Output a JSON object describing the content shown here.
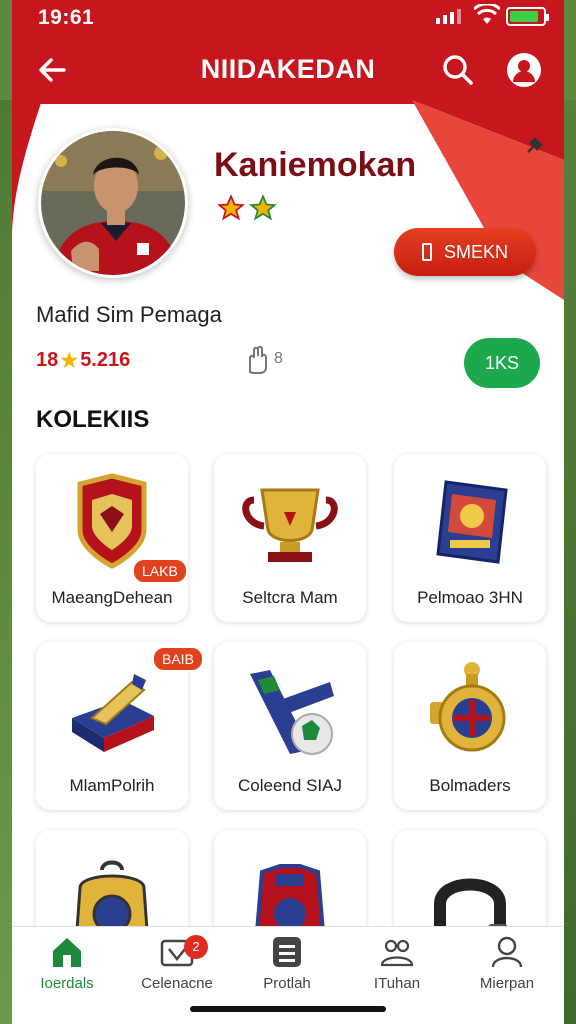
{
  "status_bar": {
    "time": "19:61"
  },
  "nav": {
    "title": "NIIDAKEDAN"
  },
  "profile": {
    "name": "Kaniemokan",
    "subtitle": "Mafid Sim Pemaga",
    "rating": "18",
    "rating_value": "5.216",
    "hand_count": "8",
    "action_red": "SMEKN",
    "action_green": "1KS"
  },
  "collection": {
    "title": "KOLEKIIS",
    "items": [
      {
        "label": "MaeangDehean",
        "badge": "LAKB",
        "icon": "jersey-shield"
      },
      {
        "label": "Seltcra Mam",
        "badge": "",
        "icon": "trophy-cup"
      },
      {
        "label": "Pelmoao 3HN",
        "badge": "",
        "icon": "card-pack"
      },
      {
        "label": "MlamPolrih",
        "badge": "BAIB",
        "icon": "scarf-box"
      },
      {
        "label": "Coleend SIAJ",
        "badge": "",
        "icon": "scarf-ball"
      },
      {
        "label": "Bolmaders",
        "badge": "",
        "icon": "medal"
      },
      {
        "label": "",
        "badge": "",
        "icon": "backpack"
      },
      {
        "label": "",
        "badge": "",
        "icon": "shirt"
      },
      {
        "label": "",
        "badge": "",
        "icon": "headphones"
      }
    ]
  },
  "bottom_nav": {
    "items": [
      {
        "label": "Ioerdals",
        "icon": "home-icon"
      },
      {
        "label": "Celenacne",
        "icon": "inbox-icon",
        "badge": "2"
      },
      {
        "label": "Protlah",
        "icon": "list-icon"
      },
      {
        "label": "ITuhan",
        "icon": "group-icon"
      },
      {
        "label": "Mierpan",
        "icon": "person-icon"
      }
    ]
  },
  "colors": {
    "brand_red": "#c8161e",
    "accent_green": "#1ea84e",
    "star_yellow": "#f4b400"
  }
}
